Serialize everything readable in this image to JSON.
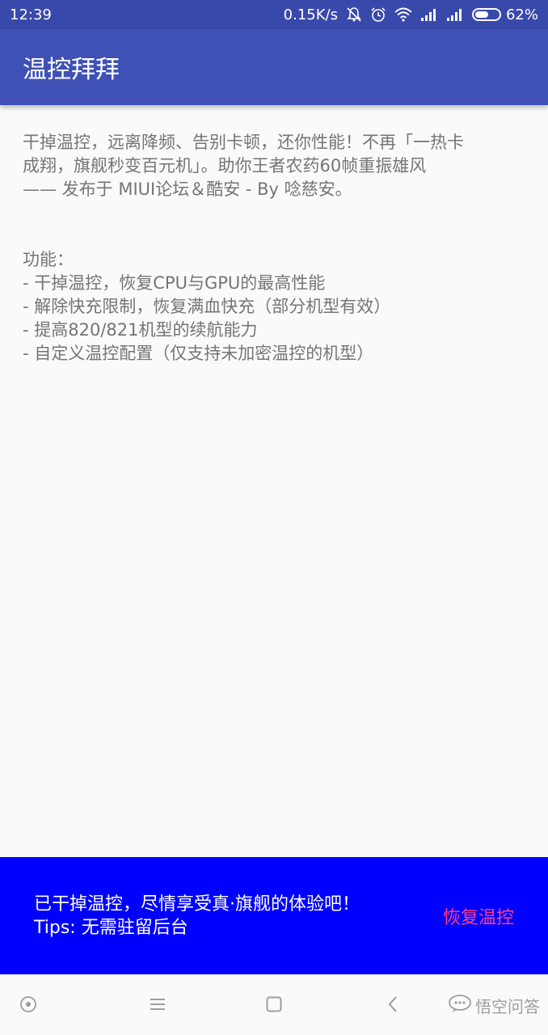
{
  "status_bar": {
    "time": "12:39",
    "net_speed": "0.15K/s",
    "battery_text": "62%",
    "battery_level": 0.62,
    "icons": [
      "mute-icon",
      "alarm-icon",
      "wifi-icon",
      "signal-icon",
      "signal-icon",
      "battery-icon"
    ]
  },
  "app_bar": {
    "title": "温控拜拜"
  },
  "content": {
    "intro_lines": [
      "干掉温控，远离降频、告别卡顿，还你性能！不再「一热卡",
      "成翔，旗舰秒变百元机」。助你王者农药60帧重振雄风",
      "—— 发布于 MIUI论坛＆酷安 - By 唸慈安。"
    ],
    "features_title": "功能：",
    "features": [
      "- 干掉温控，恢复CPU与GPU的最高性能",
      "- 解除快充限制，恢复满血快充（部分机型有效）",
      "- 提高820/821机型的续航能力",
      "- 自定义温控配置（仅支持未加密温控的机型）"
    ]
  },
  "banner": {
    "message": "已干掉温控，尽情享受真·旗舰的体验吧！",
    "tips": "Tips: 无需驻留后台",
    "restore_label": "恢复温控"
  },
  "nav_bar": {
    "icons": [
      "assistant-icon",
      "menu-icon",
      "home-icon",
      "back-icon"
    ]
  },
  "watermark": {
    "text": "悟空问答"
  },
  "colors": {
    "status_bar": "#3949ab",
    "app_bar": "#3f51b5",
    "banner": "#0000ff",
    "accent": "#ff4081"
  }
}
